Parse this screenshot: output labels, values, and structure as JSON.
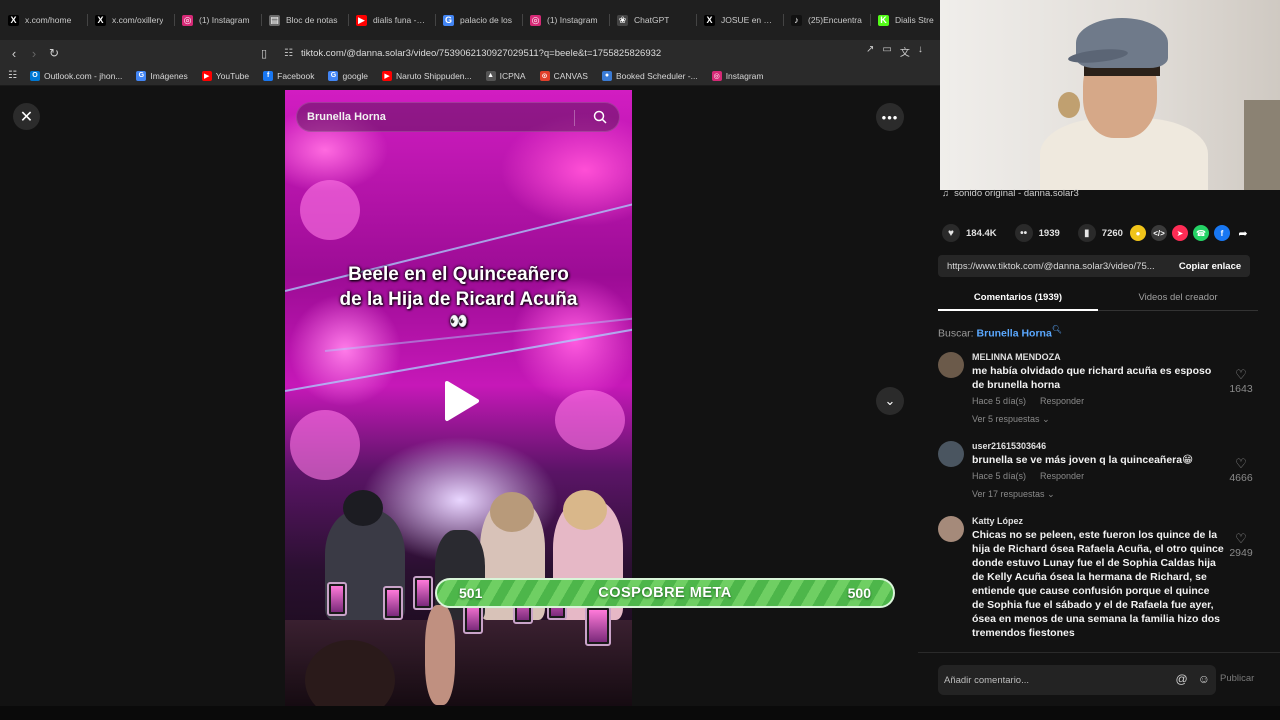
{
  "browser": {
    "tabs": [
      {
        "title": "x.com/home",
        "icon": "x-logo-icon",
        "color": "#000000"
      },
      {
        "title": "x.com/oxillery",
        "icon": "x-logo-icon",
        "color": "#000000"
      },
      {
        "title": "(1) Instagram",
        "icon": "instagram-icon",
        "color": "#d62976"
      },
      {
        "title": "Bloc de notas",
        "icon": "notepad-icon",
        "color": "#6b6b6b"
      },
      {
        "title": "dialis funa - Yo",
        "icon": "youtube-icon",
        "color": "#ff0000"
      },
      {
        "title": "palacio de los",
        "icon": "google-icon",
        "color": "#4285f4"
      },
      {
        "title": "(1) Instagram",
        "icon": "instagram-icon",
        "color": "#d62976"
      },
      {
        "title": "ChatGPT",
        "icon": "chatgpt-icon",
        "color": "#444444"
      },
      {
        "title": "JOSUE en X: \"F",
        "icon": "x-logo-icon",
        "color": "#000000"
      },
      {
        "title": "(25)Encuentra",
        "icon": "tiktok-icon",
        "color": "#111111"
      },
      {
        "title": "Dialis Stre",
        "icon": "kick-icon",
        "color": "#53fc18"
      }
    ],
    "url": "tiktok.com/@danna.solar3/video/7539062130927029511?q=beele&t=1755825826932",
    "bookmarks": [
      {
        "label": "Outlook.com - jhon...",
        "icon": "outlook-icon",
        "color": "#0078d4"
      },
      {
        "label": "Imágenes",
        "icon": "google-icon",
        "color": "#4285f4"
      },
      {
        "label": "YouTube",
        "icon": "youtube-icon",
        "color": "#ff0000"
      },
      {
        "label": "Facebook",
        "icon": "facebook-icon",
        "color": "#1877f2"
      },
      {
        "label": "google",
        "icon": "google-icon",
        "color": "#4285f4"
      },
      {
        "label": "Naruto Shippuden...",
        "icon": "youtube-icon",
        "color": "#ff0000"
      },
      {
        "label": "ICPNA",
        "icon": "icpna-icon",
        "color": "#555555"
      },
      {
        "label": "CANVAS",
        "icon": "canvas-icon",
        "color": "#e13f2b"
      },
      {
        "label": "Booked Scheduler -...",
        "icon": "booked-icon",
        "color": "#3a7bd5"
      },
      {
        "label": "Instagram",
        "icon": "instagram-icon",
        "color": "#d62976"
      }
    ]
  },
  "video": {
    "search_text": "Brunella Horna",
    "caption_line1": "Beele en el Quinceañero",
    "caption_line2": "de la Hija de Ricard Acuña",
    "caption_emoji": "👀"
  },
  "goal_bar": {
    "left_value": "501",
    "label": "COSPOBRE META",
    "right_value": "500"
  },
  "panel": {
    "sound": "sonido original - danna.solar3",
    "likes": "184.4K",
    "comments_count": "1939",
    "saves": "7260",
    "share_icons": [
      {
        "icon": "coin-icon",
        "color": "#f0c419"
      },
      {
        "icon": "embed-icon",
        "color": "#3a3a3a"
      },
      {
        "icon": "send-icon",
        "color": "#fe2c55"
      },
      {
        "icon": "whatsapp-icon",
        "color": "#25d366"
      },
      {
        "icon": "facebook-icon",
        "color": "#1877f2"
      }
    ],
    "link_url": "https://www.tiktok.com/@danna.solar3/video/75...",
    "copy_label": "Copiar enlace",
    "tab_comments": "Comentarios (1939)",
    "tab_creator": "Videos del creador",
    "search_prefix": "Buscar:",
    "search_term": "Brunella Horna",
    "comments": [
      {
        "user": "MELINNA MENDOZA",
        "text": "me había olvidado que richard acuña es esposo de brunella horna",
        "time": "Hace 5 día(s)",
        "reply": "Responder",
        "replies": "Ver 5 respuestas",
        "likes": "1643",
        "avatar_color": "#6b5a4a"
      },
      {
        "user": "user21615303646",
        "text": "brunella se ve más joven q la quinceañera😁",
        "time": "Hace 5 día(s)",
        "reply": "Responder",
        "replies": "Ver 17 respuestas",
        "likes": "4666",
        "avatar_color": "#4a5560"
      },
      {
        "user": "Katty López",
        "text": "Chicas no se peleen, este fueron los quince de la hija de Richard ósea Rafaela Acuña, el otro quince donde estuvo Lunay fue el de Sophia Caldas hija de Kelly Acuña ósea la hermana de Richard, se entiende que cause confusión porque el quince de Sophia fue el sábado y el de Rafaela fue ayer, ósea en menos de una semana la familia hizo dos tremendos fiestones",
        "time": "",
        "reply": "",
        "replies": "",
        "likes": "2949",
        "avatar_color": "#a58a7a"
      }
    ],
    "add_comment_placeholder": "Añadir comentario...",
    "publish_label": "Publicar"
  }
}
